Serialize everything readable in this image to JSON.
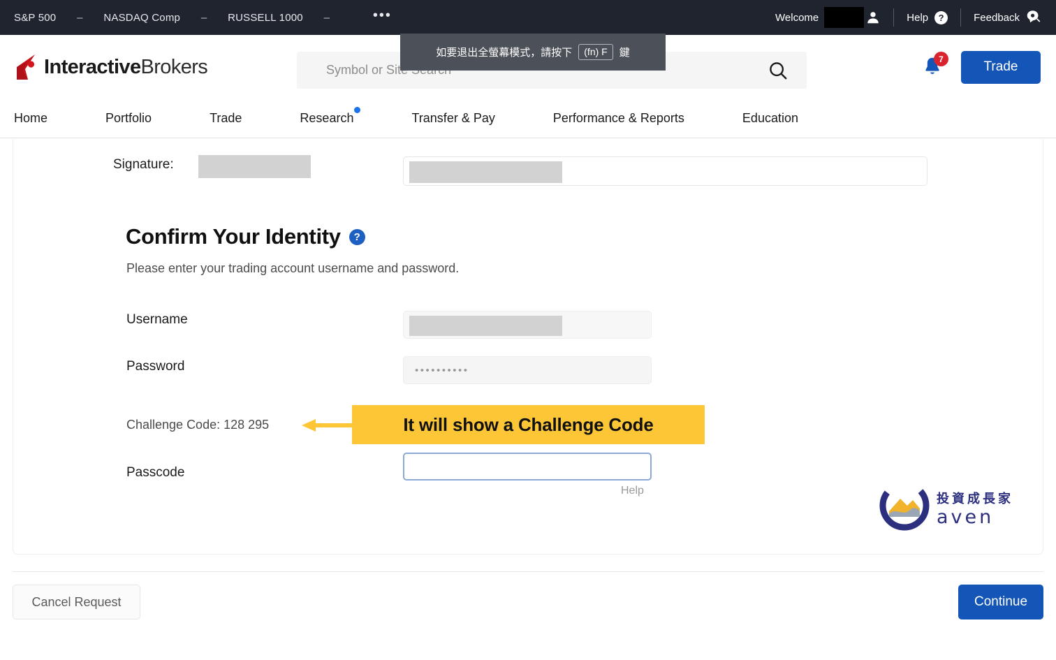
{
  "ticker": {
    "items": [
      {
        "name": "S&P 500",
        "value": "–"
      },
      {
        "name": "NASDAQ Comp",
        "value": "–"
      },
      {
        "name": "RUSSELL 1000",
        "value": "–"
      }
    ],
    "more_label": "•••",
    "welcome_label": "Welcome",
    "username_redacted": "",
    "help_label": "Help",
    "help_icon_glyph": "?",
    "feedback_label": "Feedback"
  },
  "fullscreen_tooltip": {
    "text_before": "如要退出全螢幕模式，請按下",
    "key": "(fn) F",
    "text_after": "鍵"
  },
  "header": {
    "logo_bold": "Interactive",
    "logo_light": "Brokers",
    "search_placeholder": "Symbol or Site Search",
    "search_value": "",
    "notification_count": "7",
    "trade_label": "Trade"
  },
  "nav": {
    "items": [
      {
        "label": "Home",
        "badge": false
      },
      {
        "label": "Portfolio",
        "badge": false
      },
      {
        "label": "Trade",
        "badge": false
      },
      {
        "label": "Research",
        "badge": true
      },
      {
        "label": "Transfer & Pay",
        "badge": false
      },
      {
        "label": "Performance & Reports",
        "badge": false
      },
      {
        "label": "Education",
        "badge": false
      }
    ]
  },
  "form": {
    "signature_label": "Signature:",
    "signature_value": "",
    "signature_input_value": "",
    "section_title": "Confirm Your Identity",
    "section_help_glyph": "?",
    "section_subtitle": "Please enter your trading account username and password.",
    "username_label": "Username",
    "username_value": "",
    "password_label": "Password",
    "password_value": "••••••••••",
    "challenge_code_label": "Challenge Code: 128 295",
    "passcode_label": "Passcode",
    "passcode_value": "",
    "passcode_placeholder": "",
    "help_link_label": "Help"
  },
  "annotation": {
    "text": "It will show a Challenge Code",
    "background_color": "#fcc636",
    "arrow_color": "#fcc636"
  },
  "watermark": {
    "chinese": "投資成長家",
    "english": "aven"
  },
  "footer": {
    "cancel_label": "Cancel Request",
    "continue_label": "Continue"
  },
  "colors": {
    "brand_blue": "#1456b8",
    "brand_red": "#d9232e",
    "ticker_bg": "#1f242e",
    "annotation_yellow": "#fcc636"
  }
}
